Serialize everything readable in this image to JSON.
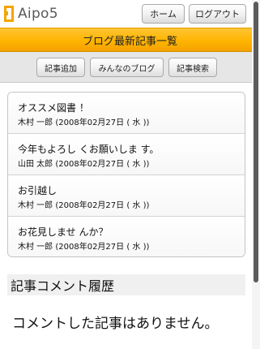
{
  "header": {
    "logo_text": "Aipo5",
    "home_label": "ホーム",
    "logout_label": "ログアウト"
  },
  "page_title": "ブログ最新記事一覧",
  "subnav": {
    "add_label": "記事追加",
    "everyone_label": "みんなのブログ",
    "search_label": "記事検索"
  },
  "posts": [
    {
      "title": "オススメ図書 ！",
      "meta": "木村 一郎 (2008年02月27日 ( 水 ))"
    },
    {
      "title": "今年もよろし くお願いしま す。",
      "meta": "山田 太郎 (2008年02月27日 ( 水 ))"
    },
    {
      "title": "お引越し",
      "meta": "木村 一郎 (2008年02月27日 ( 水 ))"
    },
    {
      "title": "お花見しませ んか？",
      "meta": "木村 一郎 (2008年02月27日 ( 水 ))"
    }
  ],
  "comments": {
    "heading": "記事コメント履歴",
    "empty_message": "コメントした記事はありません。"
  },
  "colors": {
    "accent": "#ffb400",
    "logo_orange": "#f5a400"
  }
}
